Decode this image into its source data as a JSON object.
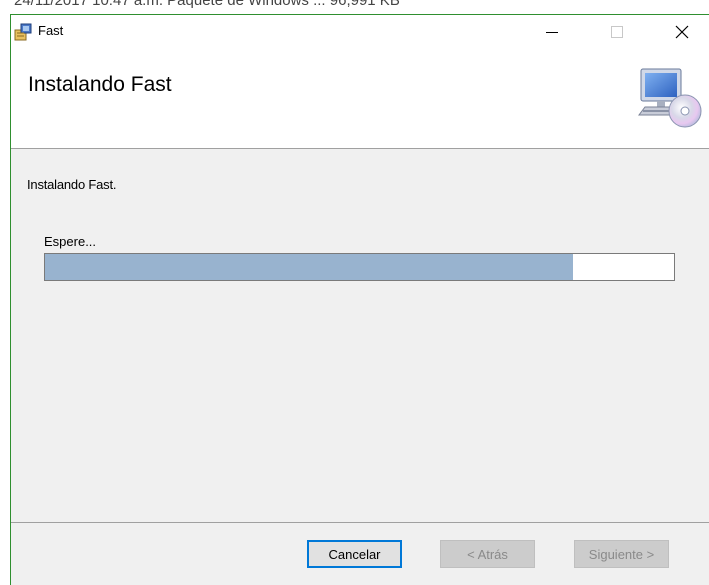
{
  "background_window": {
    "text": "24/11/2017 10:47 a.m.     Paquete de Windows ...          96,991 KB"
  },
  "window": {
    "title": "Fast",
    "controls": {
      "minimize_icon": "minimize-icon",
      "maximize_icon": "maximize-icon",
      "close_icon": "close-icon"
    }
  },
  "header": {
    "title": "Instalando Fast",
    "icon": "computer-cd-icon"
  },
  "body": {
    "status": "Instalando Fast.",
    "wait_label": "Espere...",
    "progress_fraction": 0.84
  },
  "buttons": {
    "cancel": "Cancelar",
    "back": "< Atrás",
    "next": "Siguiente >"
  },
  "colors": {
    "progress_fill": "#98b3cf",
    "window_border": "#2f8f2f",
    "focus_border": "#0078d7"
  }
}
